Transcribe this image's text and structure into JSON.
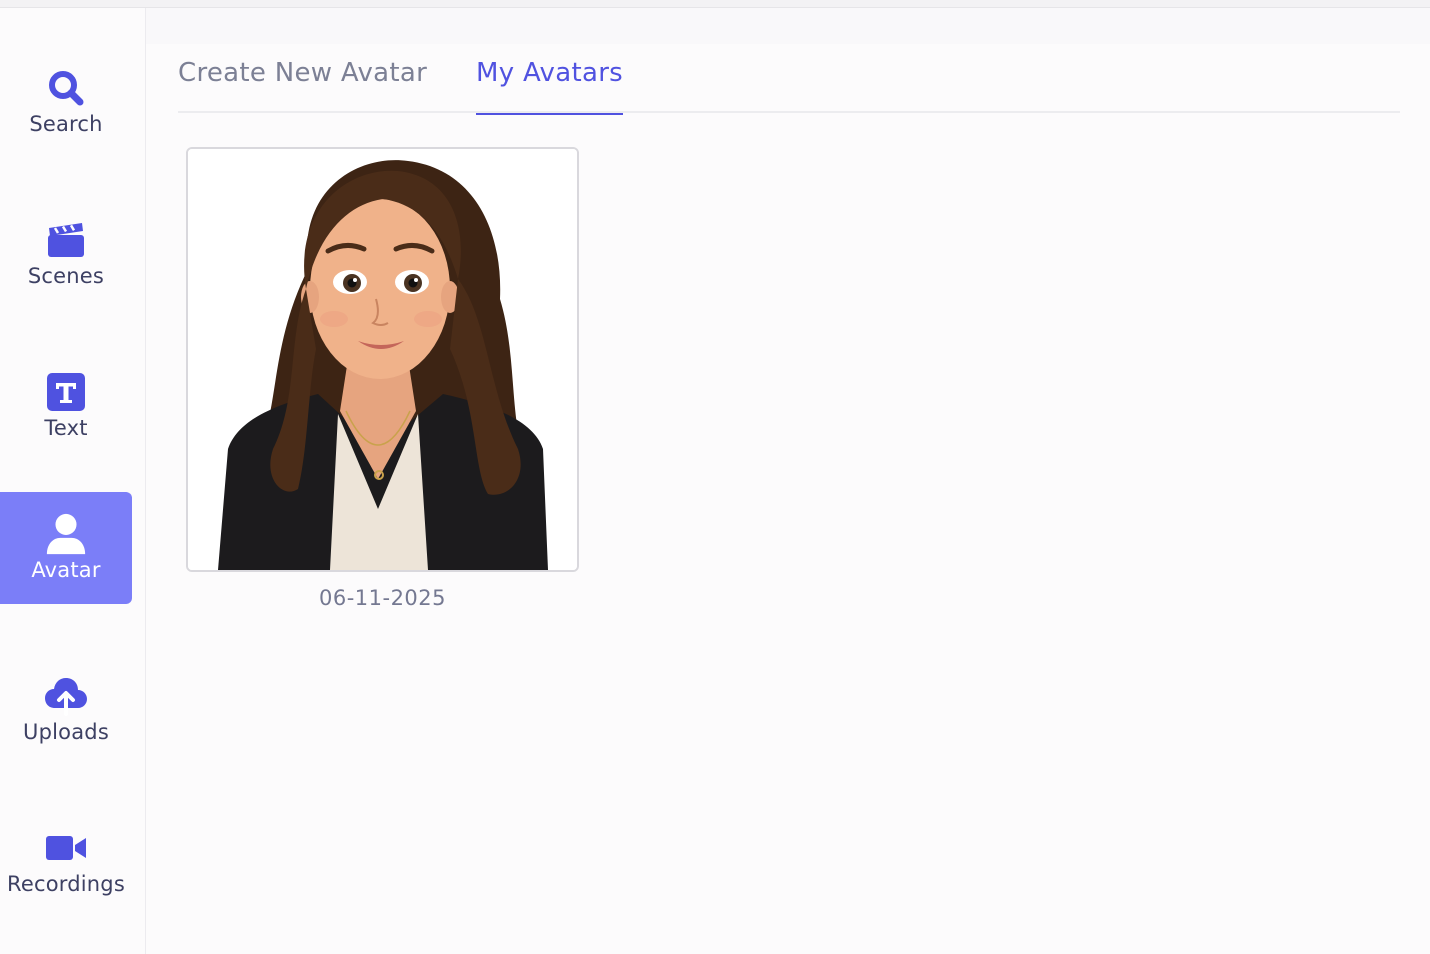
{
  "sidebar": {
    "items": [
      {
        "label": "Search",
        "icon": "search-icon"
      },
      {
        "label": "Scenes",
        "icon": "clapperboard-icon"
      },
      {
        "label": "Text",
        "icon": "text-icon"
      },
      {
        "label": "Avatar",
        "icon": "user-icon",
        "active": true
      },
      {
        "label": "Uploads",
        "icon": "cloud-upload-icon"
      },
      {
        "label": "Recordings",
        "icon": "video-camera-icon"
      }
    ]
  },
  "tabs": [
    {
      "label": "Create New Avatar"
    },
    {
      "label": "My Avatars",
      "active": true
    }
  ],
  "avatars": [
    {
      "date": "06-11-2025"
    }
  ],
  "colors": {
    "accent": "#5052e0",
    "active_bg": "#7b7ef8",
    "icon": "#4f52e0",
    "nav_text": "#3d4063",
    "muted": "#7c8095"
  }
}
